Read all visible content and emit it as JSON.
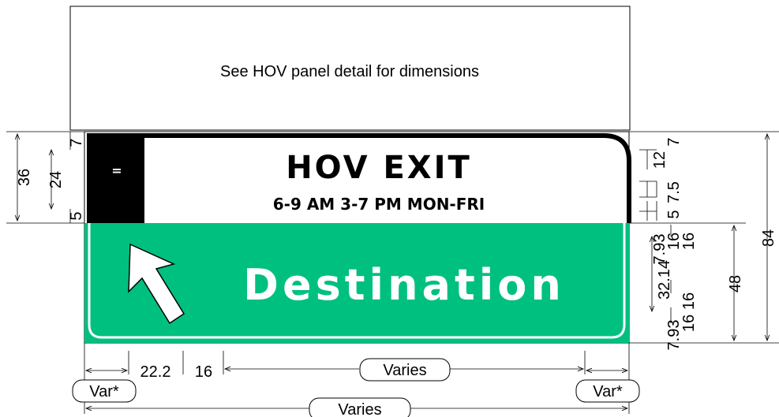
{
  "hov_panel": {
    "note": "See HOV panel detail for dimensions"
  },
  "sign": {
    "title": "HOV EXIT",
    "subtitle": "6-9 AM  3-7 PM  MON-FRI",
    "destination": "Destination",
    "diamond_glyph": "=",
    "colors": {
      "green": "#00c080",
      "black": "#000000",
      "white": "#ffffff"
    },
    "arrow_icon": "up-left-arrow-icon"
  },
  "dimensions": {
    "bottom": {
      "left_var": "Var*",
      "dim_22_2": "22.2",
      "dim_16": "16",
      "varies_mid": "Varies",
      "right_var": "Var*",
      "varies_total": "Varies"
    },
    "left": {
      "dim_36": "36",
      "dim_24": "24",
      "dim_7": "7",
      "dim_5": "5"
    },
    "right": {
      "dim_7_top": "7",
      "dim_12": "12",
      "dim_5": "5",
      "dim_7_5": "7.5",
      "dim_7_93_top": "7.93",
      "dim_16_a": "16",
      "dim_16_b": "16",
      "dim_32_14": "32.14",
      "dim_16_c": "16",
      "dim_7_93_bottom": "7.93",
      "dim_16_d": "16",
      "dim_48": "48",
      "dim_84": "84"
    }
  }
}
